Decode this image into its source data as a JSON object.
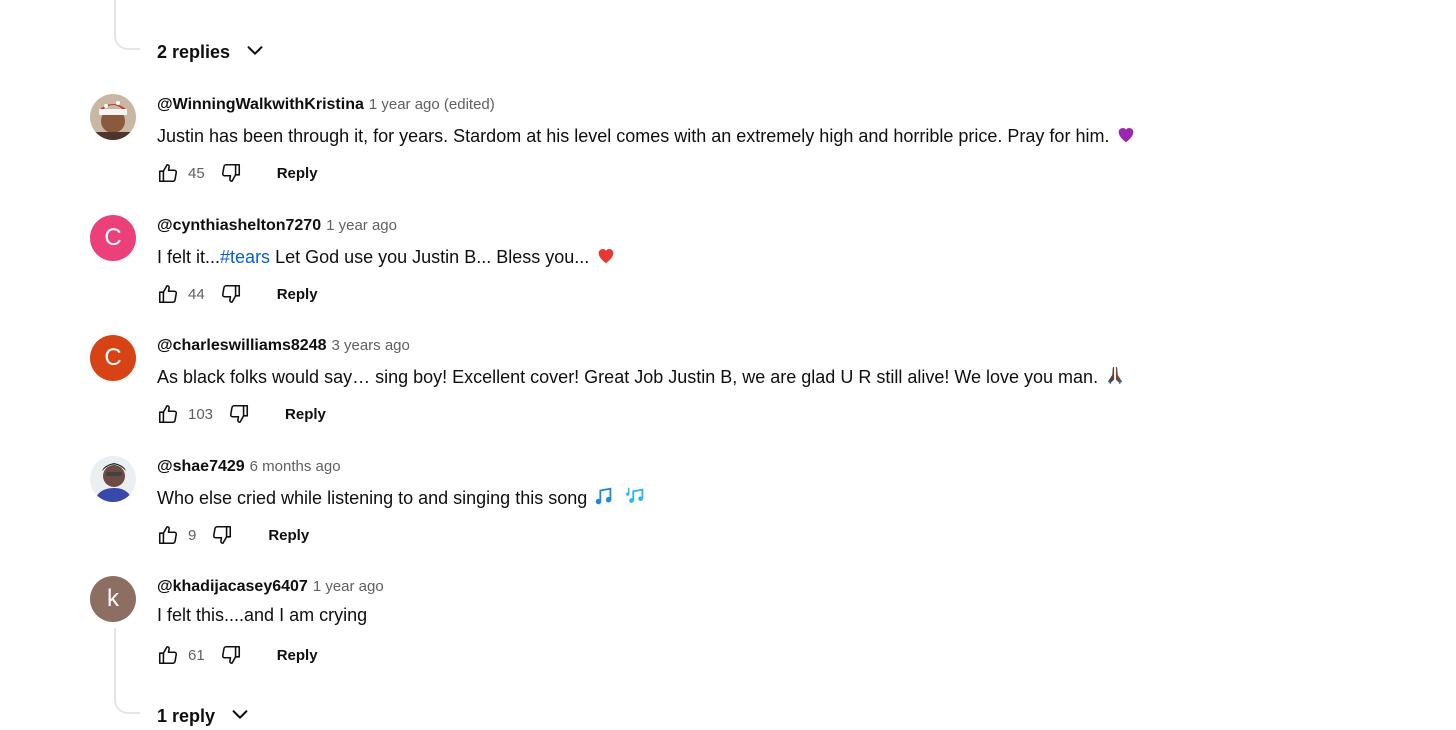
{
  "top_thread": {
    "toggle_label": "2 replies"
  },
  "comments": [
    {
      "author": "@WinningWalkwithKristina",
      "time": "1 year ago (edited)",
      "text": "Justin has been through it, for years. Stardom at his level comes with an extremely high and horrible price. Pray for him.",
      "emoji_name": "purple-heart-icon",
      "likes": "45",
      "reply_label": "Reply",
      "avatar_type": "photo"
    },
    {
      "author": "@cynthiashelton7270",
      "time": "1 year ago",
      "text_before": "I felt it...",
      "hashtag": "#tears",
      "text_after": " Let God use you Justin B... Bless you...",
      "emoji_name": "red-heart-icon",
      "likes": "44",
      "reply_label": "Reply",
      "avatar_letter": "C",
      "avatar_color": "#ec407a"
    },
    {
      "author": "@charleswilliams8248",
      "time": "3 years ago",
      "text": "As black folks would say… sing boy! Excellent cover! Great Job Justin B, we are glad U R still alive! We love you man.",
      "emoji_name": "praying-hands-icon",
      "likes": "103",
      "reply_label": "Reply",
      "avatar_letter": "C",
      "avatar_color": "#d84315"
    },
    {
      "author": "@shae7429",
      "time": "6 months ago",
      "text": "Who else cried while listening to and singing this song",
      "emoji_name": "music-notes-icon",
      "likes": "9",
      "reply_label": "Reply",
      "avatar_type": "photo"
    },
    {
      "author": "@khadijacasey6407",
      "time": "1 year ago",
      "text": "I felt this....and I am crying",
      "likes": "61",
      "reply_label": "Reply",
      "avatar_letter": "k",
      "avatar_color": "#8d6e63"
    }
  ],
  "bottom_thread": {
    "toggle_label": "1 reply"
  },
  "colors": {
    "link": "#065fd4",
    "meta": "#606060",
    "thread_line": "#e5e5e5"
  }
}
